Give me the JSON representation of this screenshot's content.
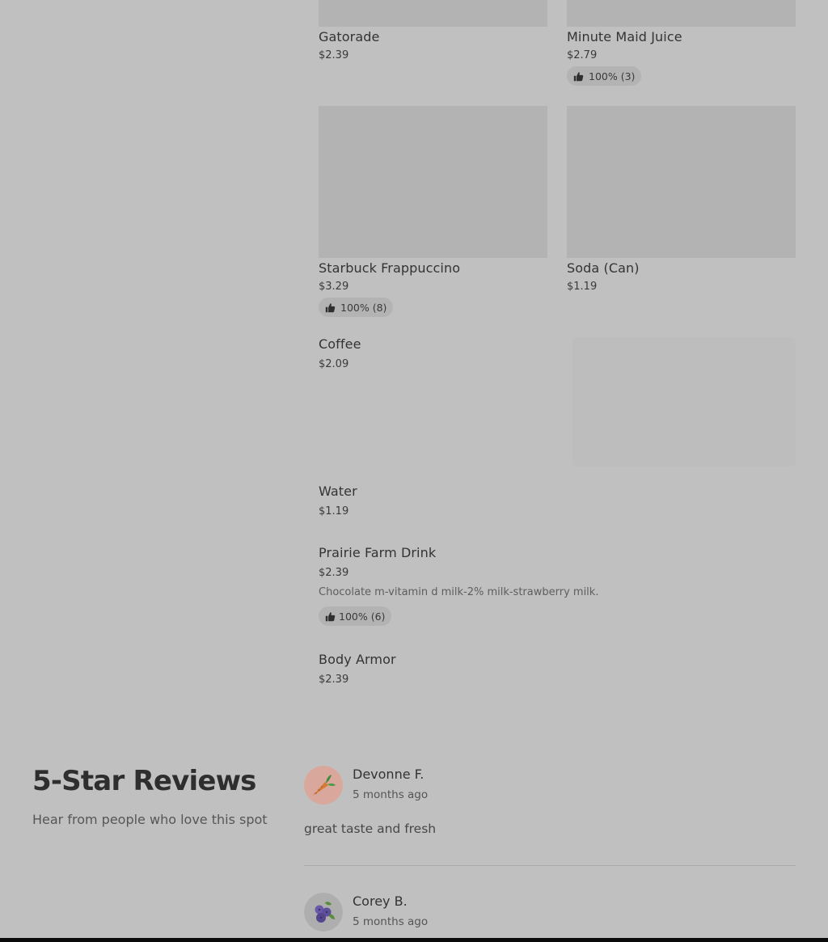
{
  "menu_items": [
    {
      "name": "Gatorade",
      "price": "$2.39"
    },
    {
      "name": "Minute Maid Juice",
      "price": "$2.79",
      "rating": "100% (3)"
    },
    {
      "name": "Starbuck Frappuccino",
      "price": "$3.29",
      "rating": "100% (8)"
    },
    {
      "name": "Soda (Can)",
      "price": "$1.19"
    },
    {
      "name": "Coffee",
      "price": "$2.09"
    },
    {
      "name": "Water",
      "price": "$1.19"
    },
    {
      "name": "Prairie Farm Drink",
      "price": "$2.39",
      "description": "Chocolate m-vitamin d milk-2% milk-strawberry milk.",
      "rating": "100% (6)"
    },
    {
      "name": "Body Armor",
      "price": "$2.39"
    }
  ],
  "reviews_section": {
    "title": "5-Star Reviews",
    "subtitle": "Hear from people who love this spot",
    "reviews": [
      {
        "name": "Devonne F.",
        "time": "5 months ago",
        "text": "great taste and fresh",
        "avatar_icon": "carrot-icon"
      },
      {
        "name": "Corey B.",
        "time": "5 months ago",
        "avatar_icon": "blueberries-icon"
      }
    ]
  },
  "icons": {
    "rating": "thumbs-up-icon"
  },
  "colors": {
    "background": "#c0c0c0",
    "placeholder": "#b3b3b3",
    "text": "#333333"
  }
}
